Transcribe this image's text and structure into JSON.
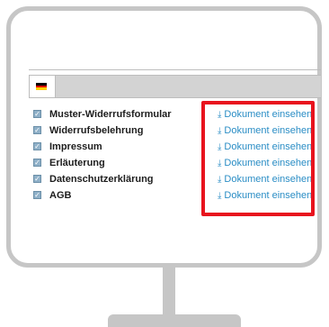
{
  "colors": {
    "accent_link": "#2a8dc5",
    "highlight": "#e8141e",
    "monitor_frame": "#c6c6c6"
  },
  "tab": {
    "icon": "flag-de-icon",
    "flag_colors": [
      "#000000",
      "#dd0000",
      "#ffce00"
    ]
  },
  "documents": [
    {
      "label": "Muster-Widerrufsformular",
      "link_text": "Dokument einsehen",
      "link_icon": "download-icon"
    },
    {
      "label": "Widerrufsbelehrung",
      "link_text": "Dokument einsehen",
      "link_icon": "download-icon"
    },
    {
      "label": "Impressum",
      "link_text": "Dokument einsehen",
      "link_icon": "download-icon"
    },
    {
      "label": "Erläuterung",
      "link_text": "Dokument einsehen",
      "link_icon": "download-icon"
    },
    {
      "label": "Datenschutzerklärung",
      "link_text": "Dokument einsehen",
      "link_icon": "download-icon"
    },
    {
      "label": "AGB",
      "link_text": "Dokument einsehen",
      "link_icon": "download-icon"
    }
  ]
}
